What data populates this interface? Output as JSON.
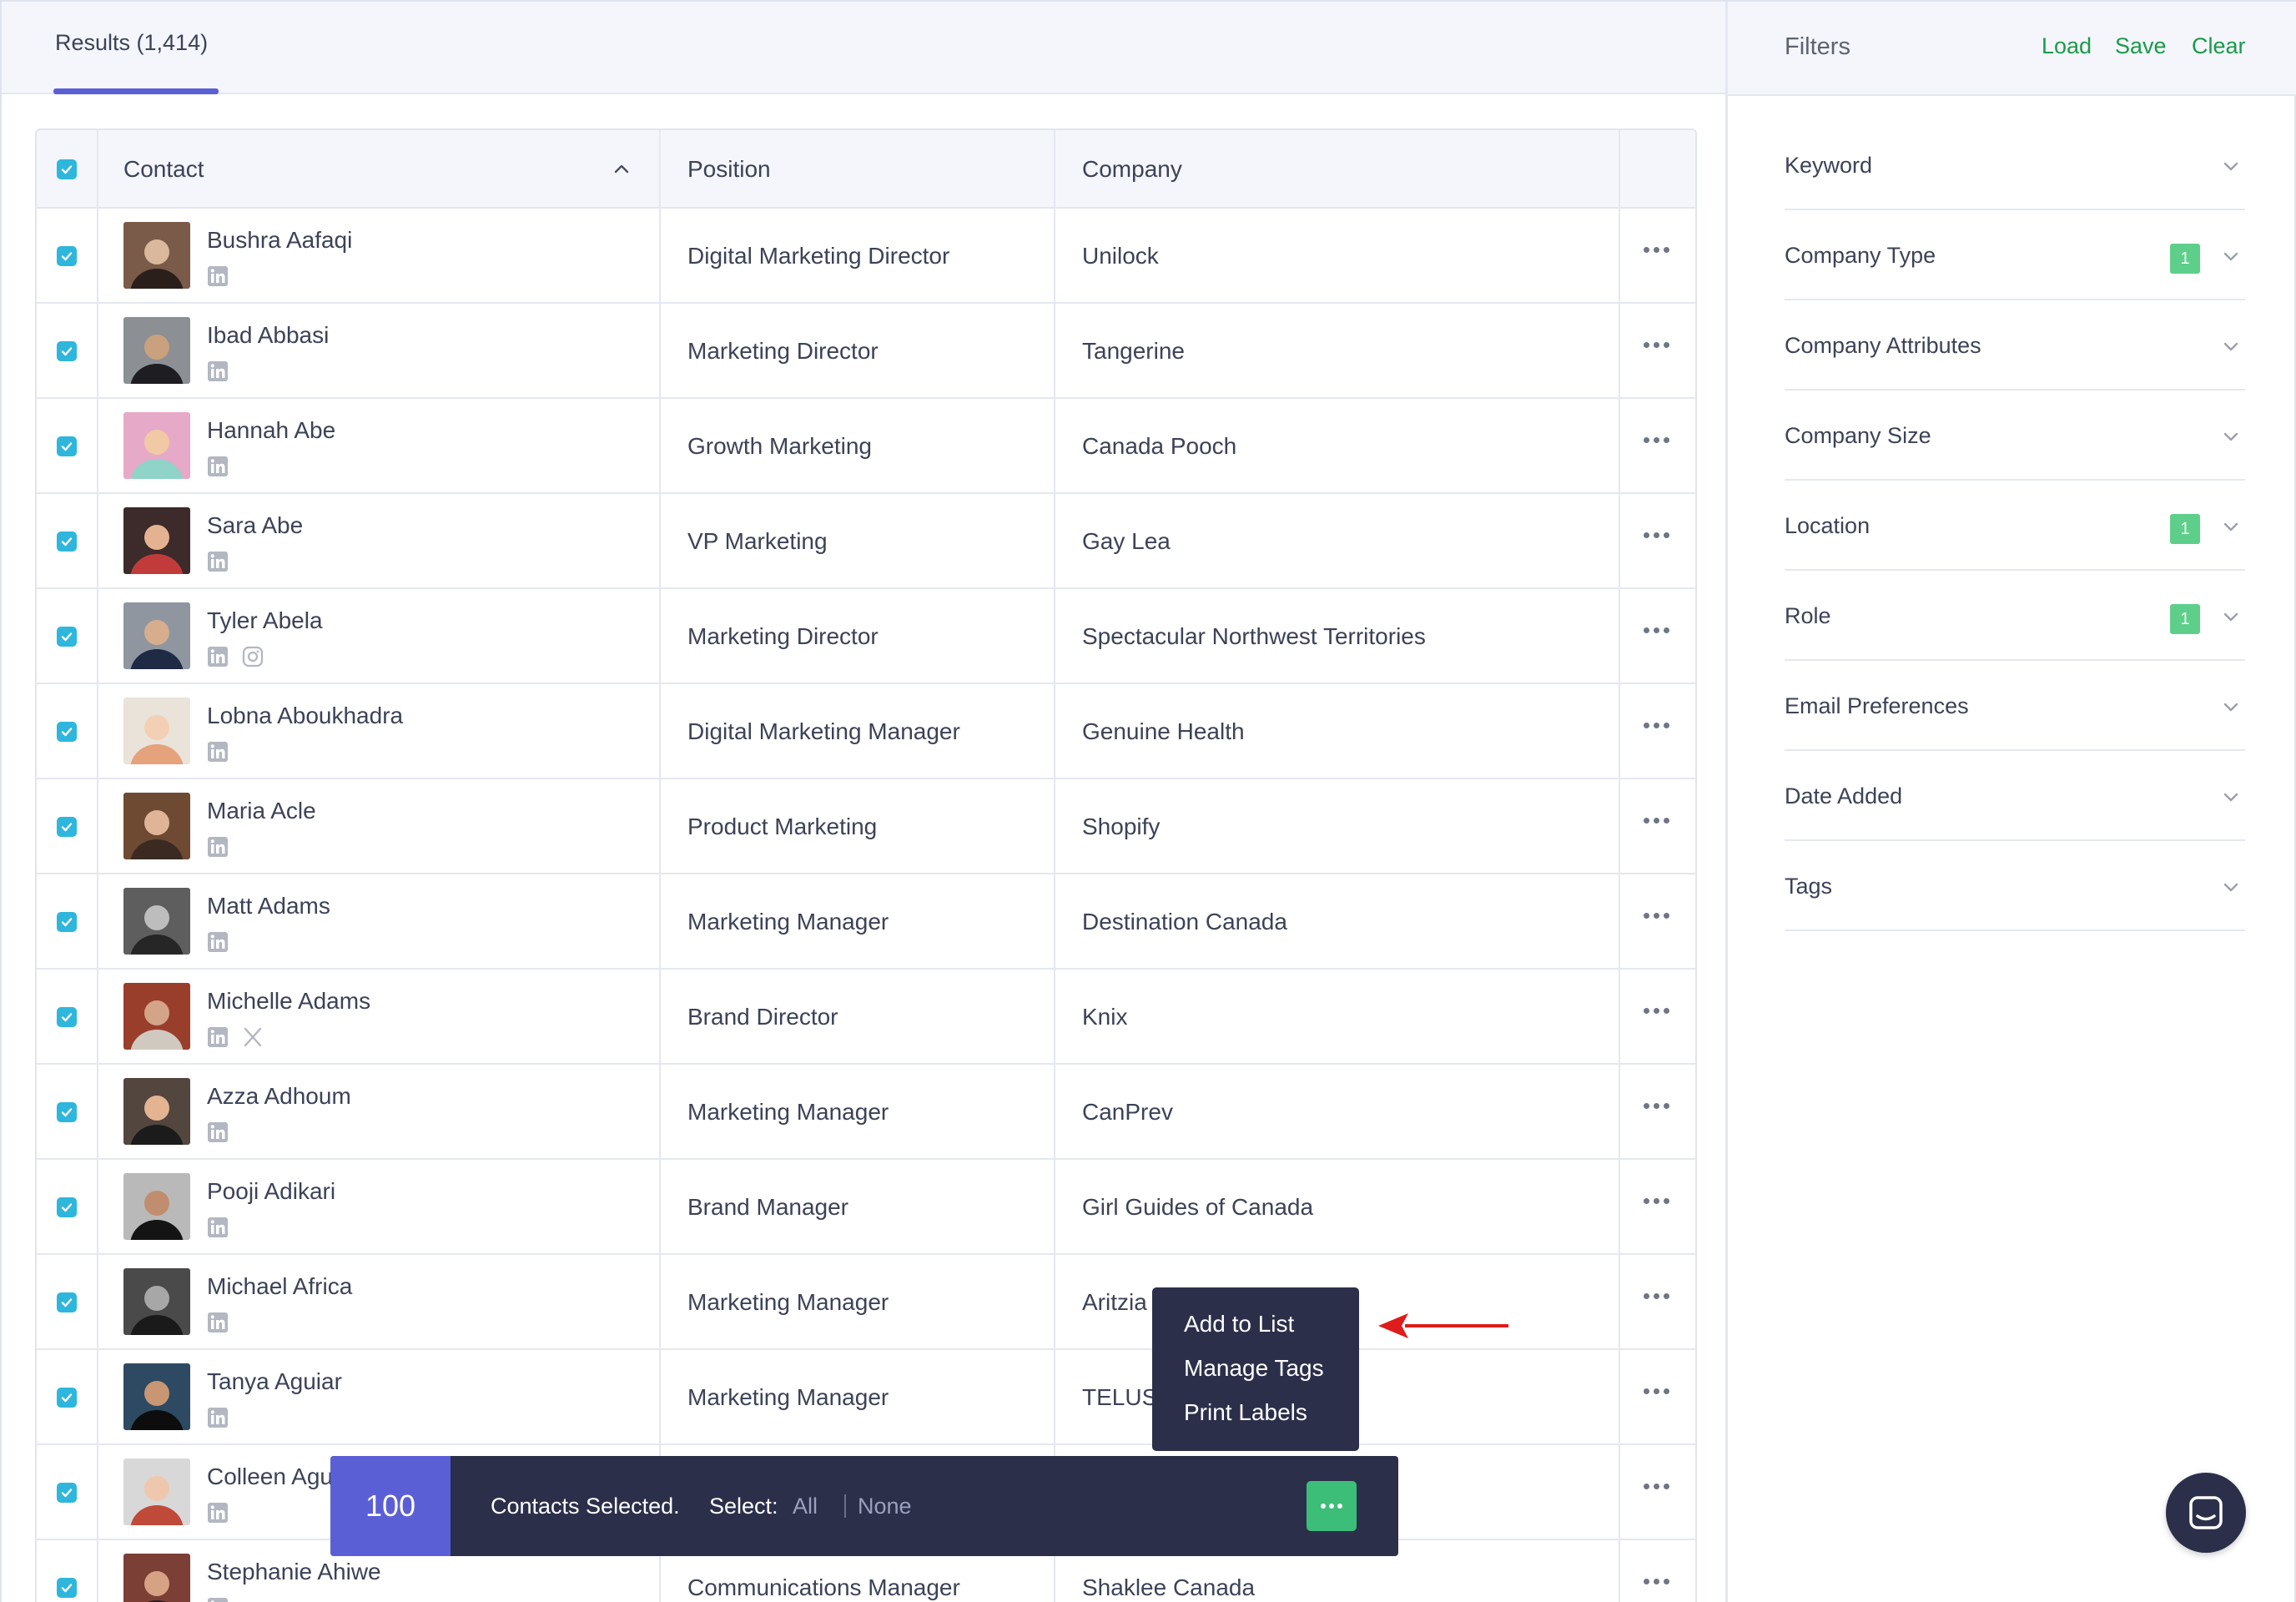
{
  "results_tab": "Results (1,414)",
  "table": {
    "headers": {
      "contact": "Contact",
      "position": "Position",
      "company": "Company"
    },
    "rows": [
      {
        "name": "Bushra Aafaqi",
        "position": "Digital Marketing Director",
        "company": "Unilock",
        "socials": [
          "linkedin-icon"
        ]
      },
      {
        "name": "Ibad Abbasi",
        "position": "Marketing Director",
        "company": "Tangerine",
        "socials": [
          "linkedin-icon"
        ]
      },
      {
        "name": "Hannah Abe",
        "position": "Growth Marketing",
        "company": "Canada Pooch",
        "socials": [
          "linkedin-icon"
        ]
      },
      {
        "name": "Sara Abe",
        "position": "VP Marketing",
        "company": "Gay Lea",
        "socials": [
          "linkedin-icon"
        ]
      },
      {
        "name": "Tyler Abela",
        "position": "Marketing Director",
        "company": "Spectacular Northwest Territories",
        "socials": [
          "linkedin-icon",
          "instagram-icon"
        ]
      },
      {
        "name": "Lobna Aboukhadra",
        "position": "Digital Marketing Manager",
        "company": "Genuine Health",
        "socials": [
          "linkedin-icon"
        ]
      },
      {
        "name": "Maria Acle",
        "position": "Product Marketing",
        "company": "Shopify",
        "socials": [
          "linkedin-icon"
        ]
      },
      {
        "name": "Matt Adams",
        "position": "Marketing Manager",
        "company": "Destination Canada",
        "socials": [
          "linkedin-icon"
        ]
      },
      {
        "name": "Michelle Adams",
        "position": "Brand Director",
        "company": "Knix",
        "socials": [
          "linkedin-icon",
          "x-icon"
        ]
      },
      {
        "name": "Azza Adhoum",
        "position": "Marketing Manager",
        "company": "CanPrev",
        "socials": [
          "linkedin-icon"
        ]
      },
      {
        "name": "Pooji Adikari",
        "position": "Brand Manager",
        "company": "Girl Guides of Canada",
        "socials": [
          "linkedin-icon"
        ]
      },
      {
        "name": "Michael Africa",
        "position": "Marketing Manager",
        "company": "Aritzia",
        "socials": [
          "linkedin-icon"
        ]
      },
      {
        "name": "Tanya Aguiar",
        "position": "Marketing Manager",
        "company": "TELUS",
        "socials": [
          "linkedin-icon"
        ]
      },
      {
        "name": "Colleen Agu",
        "position": "",
        "company": "",
        "socials": [
          "linkedin-icon"
        ]
      },
      {
        "name": "Stephanie Ahiwe",
        "position": "Communications Manager",
        "company": "Shaklee Canada",
        "socials": [
          "linkedin-icon"
        ]
      }
    ]
  },
  "filters": {
    "title": "Filters",
    "load": "Load",
    "save": "Save",
    "clear": "Clear",
    "items": [
      {
        "label": "Keyword",
        "badge": ""
      },
      {
        "label": "Company Type",
        "badge": "1"
      },
      {
        "label": "Company Attributes",
        "badge": ""
      },
      {
        "label": "Company Size",
        "badge": ""
      },
      {
        "label": "Location",
        "badge": "1"
      },
      {
        "label": "Role",
        "badge": "1"
      },
      {
        "label": "Email Preferences",
        "badge": ""
      },
      {
        "label": "Date Added",
        "badge": ""
      },
      {
        "label": "Tags",
        "badge": ""
      }
    ]
  },
  "selection_bar": {
    "count": "100",
    "text": "Contacts Selected.",
    "select_label": "Select:",
    "all": "All",
    "none": "None"
  },
  "context_menu": {
    "items": [
      "Add to List",
      "Manage Tags",
      "Print Labels"
    ]
  },
  "colors": {
    "accent": "#5b5fd6",
    "checkbox": "#2fb6dc",
    "filter_link": "#1a9a4b",
    "badge": "#5ecf8a",
    "dark_panel": "#2b2f4a",
    "arrow": "#e01b1b"
  }
}
